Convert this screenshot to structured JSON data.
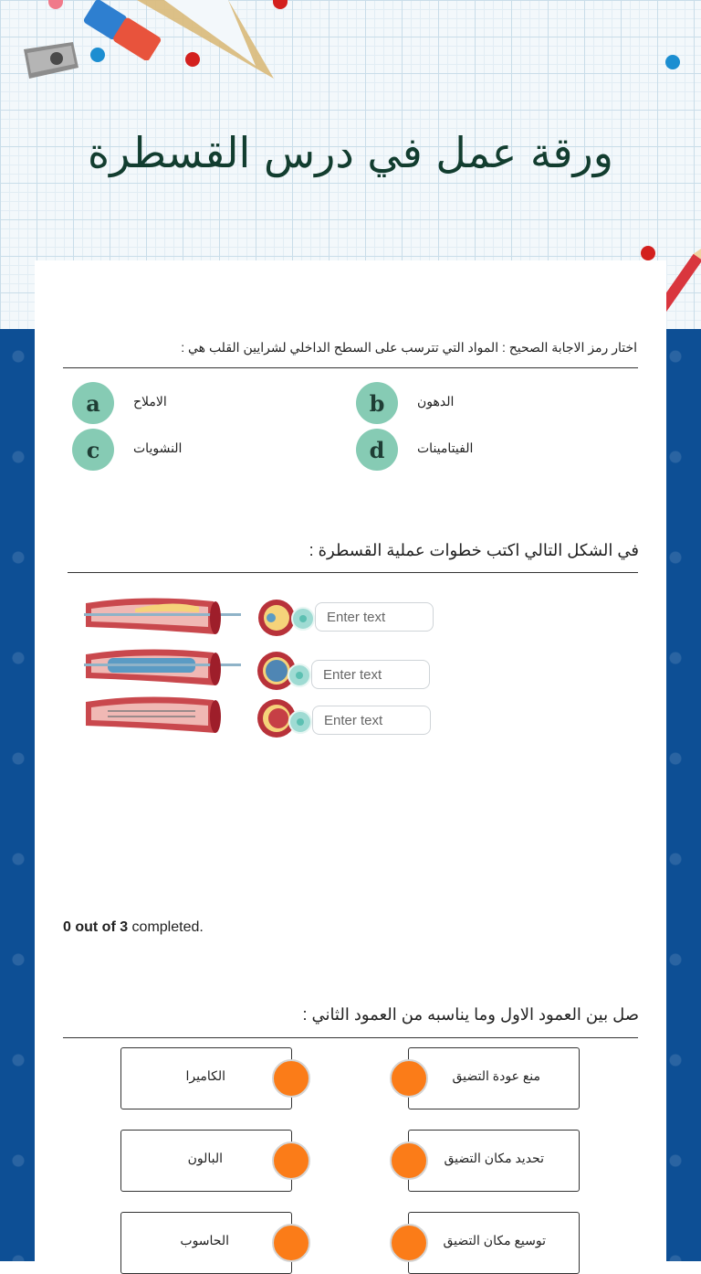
{
  "header": {
    "title": "ورقة عمل في درس القسطرة"
  },
  "question1": {
    "prompt": "اختار رمز الاجابة الصحيح : المواد التي تترسب على السطح الداخلي لشرايين القلب هي :",
    "options": [
      {
        "letter": "a",
        "label": "الاملاح"
      },
      {
        "letter": "b",
        "label": "الدهون"
      },
      {
        "letter": "c",
        "label": "النشويات"
      },
      {
        "letter": "d",
        "label": "الفيتامينات"
      }
    ]
  },
  "question2": {
    "prompt": "في الشكل التالي اكتب خطوات عملية القسطرة :",
    "inputs": [
      {
        "placeholder": "Enter text",
        "value": ""
      },
      {
        "placeholder": "Enter text",
        "value": ""
      },
      {
        "placeholder": "Enter text",
        "value": ""
      }
    ],
    "progress_count": "0 out of 3",
    "progress_suffix": " completed."
  },
  "question3": {
    "prompt": "صل بين العمود الاول وما يناسبه من العمود الثاني  :",
    "left_column": [
      "الكاميرا",
      "البالون",
      "الحاسوب"
    ],
    "right_column": [
      "منع عودة التضيق",
      "تحديد مكان التضيق",
      "توسيع مكان التضيق"
    ]
  },
  "colors": {
    "accent_badge": "#86cbb4",
    "match_knob": "#fb7c18",
    "background_blue": "#0d4f95",
    "title_green": "#123d2f"
  }
}
